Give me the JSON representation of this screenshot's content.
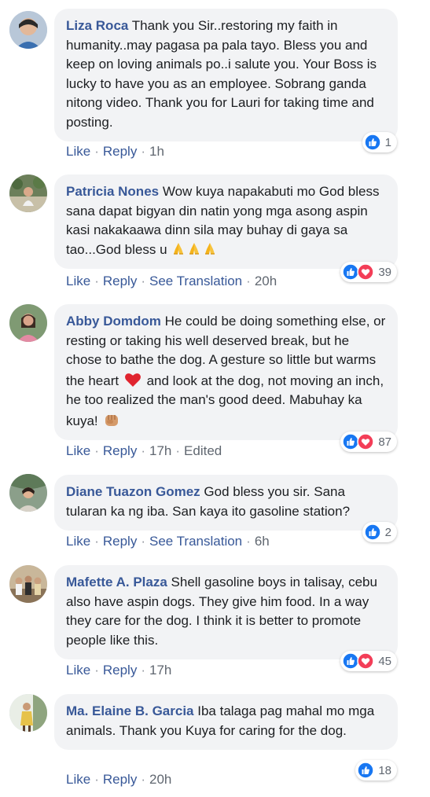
{
  "colors": {
    "author": "#385898",
    "bubble": "#f2f3f5",
    "like_blue": "#1877f2",
    "love_red": "#f33e58",
    "meta_gray": "#606770"
  },
  "comments": [
    {
      "author": "Liza Roca",
      "text": "Thank you Sir..restoring my faith in humanity..may pagasa pa pala tayo. Bless you and keep on loving animals po..i salute you. Your Boss is lucky to have you as an employee. Sobrang ganda nitong video. Thank you for Lauri for taking time and posting.",
      "like": "Like",
      "reply": "Reply",
      "time": "1h",
      "reaction_count": "1",
      "reaction_icons": [
        "like-icon"
      ]
    },
    {
      "author": "Patricia Nones",
      "text": "Wow kuya napakabuti mo God bless sana dapat bigyan din natin yong mga asong aspin kasi nakakaawa dinn sila may buhay di gaya sa tao...God bless u",
      "emoji": [
        "folded-hands-icon",
        "folded-hands-icon",
        "folded-hands-icon"
      ],
      "like": "Like",
      "reply": "Reply",
      "translation": "See Translation",
      "time": "20h",
      "reaction_count": "39",
      "reaction_icons": [
        "like-icon",
        "love-icon"
      ]
    },
    {
      "author": "Abby Domdom",
      "text_a": "He could be doing something else, or resting or taking his well deserved break, but he chose to bathe the dog. A gesture so little but warms the heart",
      "emoji_mid": "red-heart-icon",
      "text_b": "and look at the dog, not moving an inch, he too realized the man's good deed. Mabuhay ka kuya!",
      "emoji_end": "fist-bump-icon",
      "like": "Like",
      "reply": "Reply",
      "time": "17h",
      "edited": "Edited",
      "reaction_count": "87",
      "reaction_icons": [
        "like-icon",
        "love-icon"
      ]
    },
    {
      "author": "Diane Tuazon Gomez",
      "text": "God bless you sir. Sana tularan ka ng iba. San kaya ito gasoline station?",
      "like": "Like",
      "reply": "Reply",
      "translation": "See Translation",
      "time": "6h",
      "reaction_count": "2",
      "reaction_icons": [
        "like-icon"
      ]
    },
    {
      "author": "Mafette A. Plaza",
      "text": "Shell gasoline boys in talisay, cebu also have aspin dogs. They give him food. In a way they care for the dog. I think it is better to promote people like this.",
      "like": "Like",
      "reply": "Reply",
      "time": "17h",
      "reaction_count": "45",
      "reaction_icons": [
        "like-icon",
        "love-icon"
      ]
    },
    {
      "author": "Ma. Elaine B. Garcia",
      "text": "Iba talaga pag mahal mo mga animals. Thank you Kuya for caring for the dog.",
      "like": "Like",
      "reply": "Reply",
      "time": "20h",
      "reaction_count": "18",
      "reaction_icons": [
        "like-icon"
      ]
    }
  ]
}
